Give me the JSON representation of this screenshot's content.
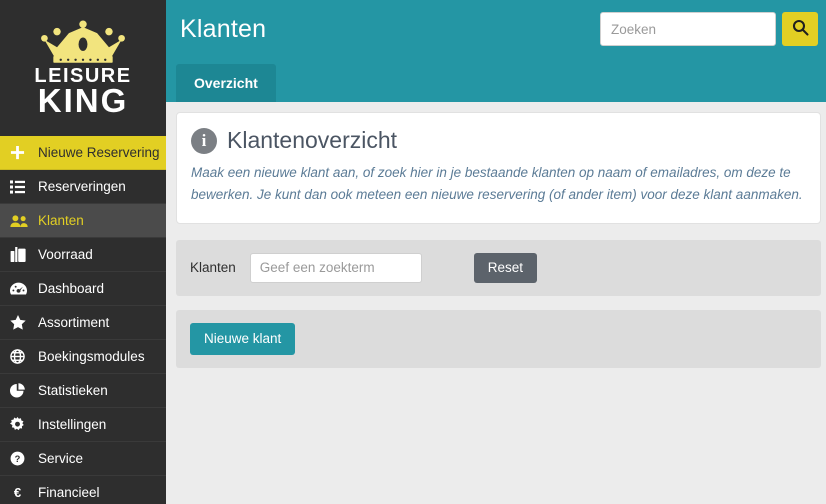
{
  "brand": {
    "line1": "LEISURE",
    "line2": "KING",
    "crown_icon": "crown-icon",
    "accent_yellow": "#e2cf23",
    "sidebar_bg": "#2e2e2e"
  },
  "sidebar": {
    "items": [
      {
        "label": "Nieuwe Reservering",
        "icon": "plus-icon",
        "state": "yellow"
      },
      {
        "label": "Reserveringen",
        "icon": "list-icon",
        "state": "normal"
      },
      {
        "label": "Klanten",
        "icon": "users-icon",
        "state": "active"
      },
      {
        "label": "Voorraad",
        "icon": "briefcase-icon",
        "state": "normal"
      },
      {
        "label": "Dashboard",
        "icon": "tachometer-icon",
        "state": "normal"
      },
      {
        "label": "Assortiment",
        "icon": "star-icon",
        "state": "normal"
      },
      {
        "label": "Boekingsmodules",
        "icon": "globe-icon",
        "state": "normal"
      },
      {
        "label": "Statistieken",
        "icon": "pie-chart-icon",
        "state": "normal"
      },
      {
        "label": "Instellingen",
        "icon": "gear-icon",
        "state": "normal"
      },
      {
        "label": "Service",
        "icon": "question-circle-icon",
        "state": "normal"
      },
      {
        "label": "Financieel",
        "icon": "euro-icon",
        "state": "normal"
      }
    ]
  },
  "header": {
    "title": "Klanten",
    "accent": "#2496a4",
    "search": {
      "value": "",
      "placeholder": "Zoeken",
      "button_icon": "search-icon",
      "button_color": "#e2cf23"
    }
  },
  "tabs": [
    {
      "label": "Overzicht",
      "active": true
    }
  ],
  "info_card": {
    "badge_icon": "info-icon",
    "badge_glyph": "i",
    "title": "Klantenoverzicht",
    "description": "Maak een nieuwe klant aan, of zoek hier in je bestaande klanten op naam of emailadres, om deze te bewerken. Je kunt dan ook meteen een nieuwe reservering (of ander item) voor deze klant aanmaken."
  },
  "filter_panel": {
    "label": "Klanten",
    "input_value": "",
    "input_placeholder": "Geef een zoekterm",
    "reset_label": "Reset"
  },
  "action_panel": {
    "new_label": "Nieuwe klant"
  }
}
